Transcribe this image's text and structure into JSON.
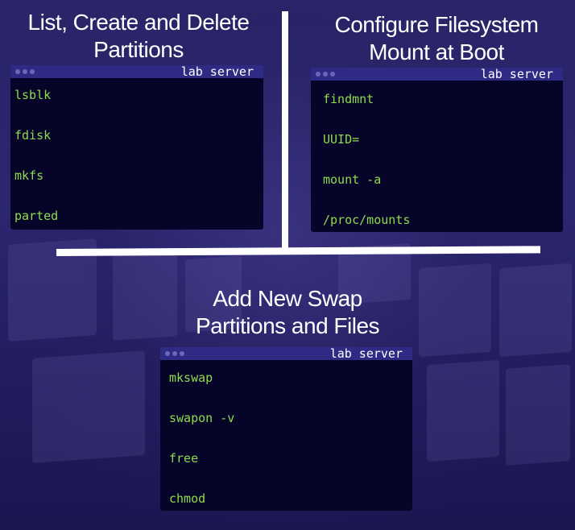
{
  "sections": {
    "partitions": {
      "heading_line1": "List, Create and Delete",
      "heading_line2": "Partitions",
      "terminal_title": "lab server",
      "commands": [
        "lsblk",
        "fdisk",
        "mkfs",
        "parted"
      ]
    },
    "fstab": {
      "heading_line1": "Configure Filesystem",
      "heading_line2": "Mount at Boot",
      "terminal_title": "lab server",
      "commands": [
        "findmnt",
        "UUID=",
        "mount -a",
        "/proc/mounts"
      ]
    },
    "swap": {
      "heading_line1": "Add New Swap",
      "heading_line2": "Partitions and Files",
      "terminal_title": "lab server",
      "commands": [
        "mkswap",
        "swapon -v",
        "free",
        "chmod"
      ]
    }
  },
  "colors": {
    "background": "#241f5a",
    "terminal_body": "#07042a",
    "terminal_bar": "#2f2a84",
    "command_text": "#8ddc4c",
    "heading_text": "#ffffff"
  }
}
